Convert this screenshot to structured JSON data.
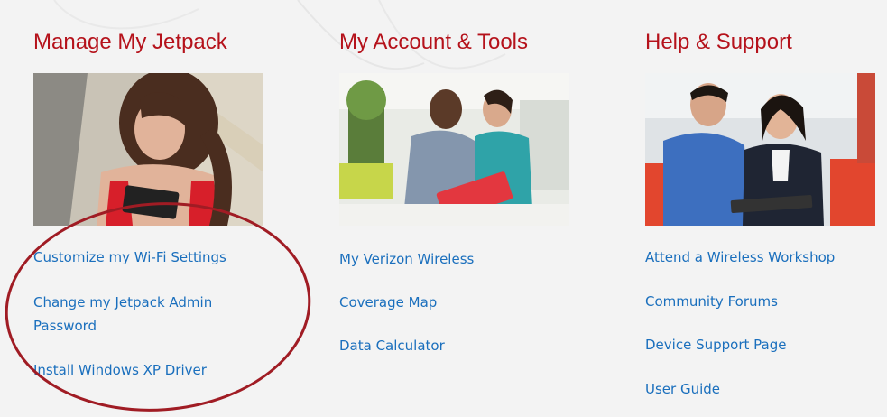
{
  "columns": [
    {
      "heading": "Manage My Jetpack",
      "photo": "woman-with-phone-photo",
      "links": [
        "Customize my Wi-Fi Settings",
        "Change my Jetpack Admin",
        "Password",
        "Install Windows XP Driver"
      ]
    },
    {
      "heading": "My Account & Tools",
      "photo": "two-people-with-tablet-photo",
      "links": [
        "My Verizon Wireless",
        "Coverage Map",
        "Data Calculator"
      ]
    },
    {
      "heading": "Help & Support",
      "photo": "couple-with-tablet-photo",
      "links": [
        "Attend a Wireless Workshop",
        "Community Forums",
        "Device Support Page",
        "User Guide"
      ]
    }
  ],
  "colors": {
    "heading": "#b5121b",
    "link": "#1a6fbd",
    "highlight_circle": "#a01c24",
    "background": "#f3f3f3"
  }
}
